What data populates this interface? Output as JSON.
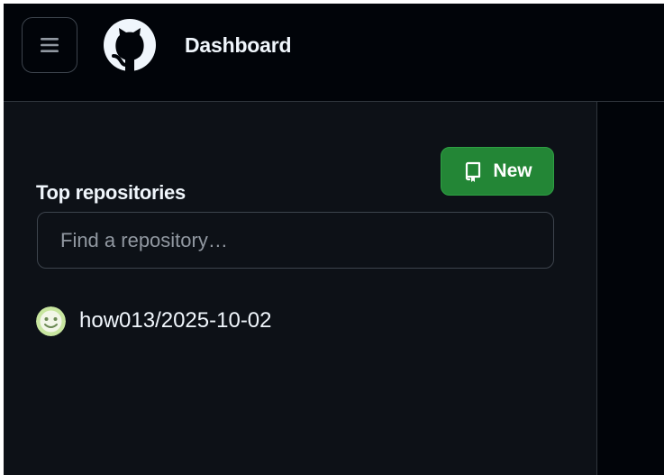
{
  "header": {
    "title": "Dashboard",
    "menu_icon": "hamburger-menu-icon",
    "logo_icon": "github-octocat-icon"
  },
  "sidebar": {
    "section_title": "Top repositories",
    "new_button": {
      "label": "New",
      "icon": "repo-icon"
    },
    "search": {
      "placeholder": "Find a repository…",
      "value": ""
    },
    "repositories": [
      {
        "name": "how013/2025-10-02",
        "avatar_icon": "user-avatar"
      }
    ]
  },
  "colors": {
    "header_background": "#010409",
    "sidebar_background": "#0d1117",
    "border": "#30363d",
    "text_primary": "#f0f6fc",
    "text_placeholder": "#9198a1",
    "new_button_background": "#238636",
    "avatar_background": "#c8e6a0"
  }
}
